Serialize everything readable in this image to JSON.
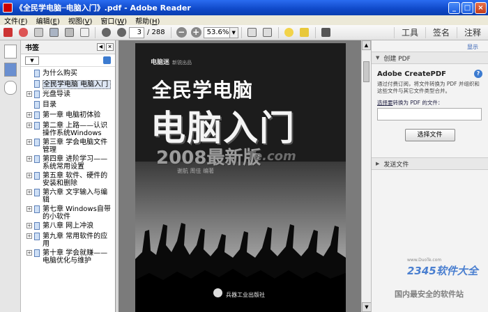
{
  "window": {
    "title": "《全民学电脑─电脑入门》.pdf - Adobe Reader",
    "min": "_",
    "max": "□",
    "close": "×"
  },
  "menu": [
    {
      "label": "文件(",
      "key": "F",
      "end": ")"
    },
    {
      "label": "编辑(",
      "key": "E",
      "end": ")"
    },
    {
      "label": "视图(",
      "key": "V",
      "end": ")"
    },
    {
      "label": "窗口(",
      "key": "W",
      "end": ")"
    },
    {
      "label": "帮助(",
      "key": "H",
      "end": ")"
    }
  ],
  "toolbar": {
    "page_current": "3",
    "page_total": "/ 288",
    "zoom": "53.6%",
    "zoom_out": "−",
    "zoom_in": "+",
    "tools": "工具",
    "sign": "签名",
    "comment": "注释"
  },
  "bookmarks": {
    "title": "书签",
    "items": [
      {
        "label": "为什么购买",
        "expandable": false,
        "selected": false
      },
      {
        "label": "全民学电脑 电脑入门",
        "expandable": false,
        "selected": true
      },
      {
        "label": "光盘导读",
        "expandable": true,
        "selected": false
      },
      {
        "label": "目录",
        "expandable": false,
        "selected": false
      },
      {
        "label": "第一章 电脑初体验",
        "expandable": true,
        "selected": false
      },
      {
        "label": "第二章 上路——认识操作系统Windows",
        "expandable": true,
        "selected": false
      },
      {
        "label": "第三章 学会电脑文件管理",
        "expandable": true,
        "selected": false
      },
      {
        "label": "第四章 进阶学习——系统常用设置",
        "expandable": true,
        "selected": false
      },
      {
        "label": "第五章 软件、硬件的安装和删除",
        "expandable": true,
        "selected": false
      },
      {
        "label": "第六章 文字输入与编辑",
        "expandable": true,
        "selected": false
      },
      {
        "label": "第七章 Windows自带的小软件",
        "expandable": true,
        "selected": false
      },
      {
        "label": "第八章 网上冲浪",
        "expandable": true,
        "selected": false
      },
      {
        "label": "第九章 常用软件的应用",
        "expandable": true,
        "selected": false
      },
      {
        "label": "第十章 学会就赚——电脑优化与维护",
        "expandable": true,
        "selected": false
      }
    ]
  },
  "cover": {
    "brand": "电脑迷",
    "brand_sub": "新锐出品",
    "title1": "全民学电脑",
    "title2": "电脑入门",
    "edition": "2008最新版",
    "watermark": "Te.com",
    "authors": "谢航  周佳  编著",
    "publisher": "兵器工业出版社"
  },
  "right_panel": {
    "show": "显示",
    "create_header": "创建 PDF",
    "create_title": "Adobe CreatePDF",
    "help": "?",
    "description": "通过付费订阅，将文件转换为 PDF 并组织和",
    "description2": "这些文件与其它文件类型合并。",
    "select_label_u": "选择要",
    "select_label": "转换为 PDF 的文件：",
    "select_button": "选择文件",
    "send_header": "发送文件"
  },
  "watermarks": {
    "site": "2345软件大全",
    "site_url": "www.DuoTe.com",
    "slogan": "国内最安全的软件站"
  }
}
